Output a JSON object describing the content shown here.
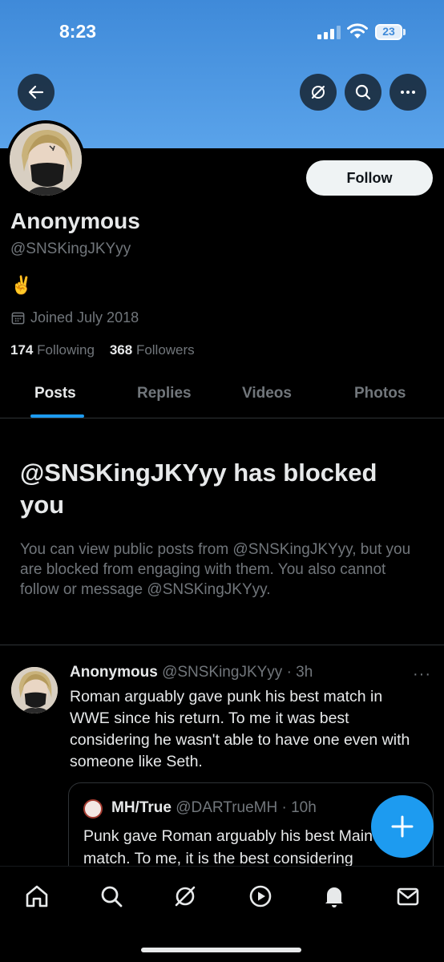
{
  "status_bar": {
    "time": "8:23",
    "battery": "23"
  },
  "profile": {
    "follow_label": "Follow",
    "display_name": "Anonymous",
    "handle": "@SNSKingJKYyy",
    "bio": "✌️",
    "joined": "Joined July 2018",
    "following_count": "174",
    "following_label": "Following",
    "followers_count": "368",
    "followers_label": "Followers"
  },
  "tabs": [
    {
      "label": "Posts",
      "active": true
    },
    {
      "label": "Replies",
      "active": false
    },
    {
      "label": "Videos",
      "active": false
    },
    {
      "label": "Photos",
      "active": false
    }
  ],
  "blocked": {
    "title": "@SNSKingJKYyy has blocked you",
    "text": "You can view public posts from @SNSKingJKYyy, but you are blocked from engaging with them. You also cannot follow or message @SNSKingJKYyy."
  },
  "post": {
    "name": "Anonymous",
    "meta": "@SNSKingJKYyy · 3h",
    "more": "···",
    "text": "Roman arguably gave punk his best match in WWE since his return. To me it was best considering he wasn't able to have one even with someone like Seth.",
    "quote": {
      "name": "MH/True",
      "meta": "@DARTrueMH · 10h",
      "text": "Punk gave Roman arguably his best Main match. To me, it is the best considering"
    }
  },
  "colors": {
    "accent": "#1d9bf0",
    "banner": "#4a96e0",
    "background": "#000000",
    "secondary_text": "#71767b"
  }
}
